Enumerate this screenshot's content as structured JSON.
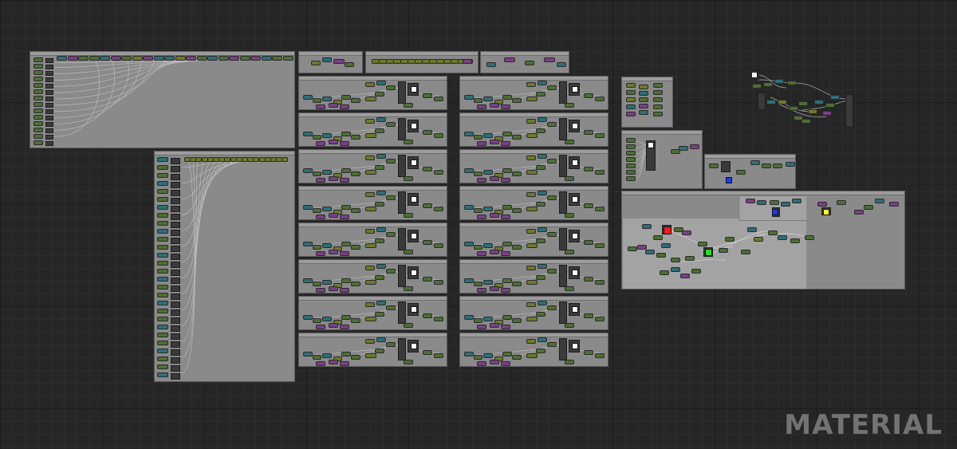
{
  "editor": {
    "watermark": "MATERIAL"
  },
  "colors": {
    "canvas": "#262626",
    "comment_box": "#8a8a8a",
    "node_green": "#4e6e34",
    "node_teal": "#2d6f78",
    "node_purple": "#7a3f86",
    "node_olive": "#6c7a2b",
    "node_dark": "#3a3a3a",
    "swatch_white": "#ffffff",
    "swatch_red": "#ff1a1a",
    "swatch_green": "#22e022",
    "swatch_blue": "#1a3bff",
    "swatch_yellow": "#ffff22"
  },
  "swatches": [
    "white",
    "red",
    "green",
    "blue",
    "yellow"
  ]
}
